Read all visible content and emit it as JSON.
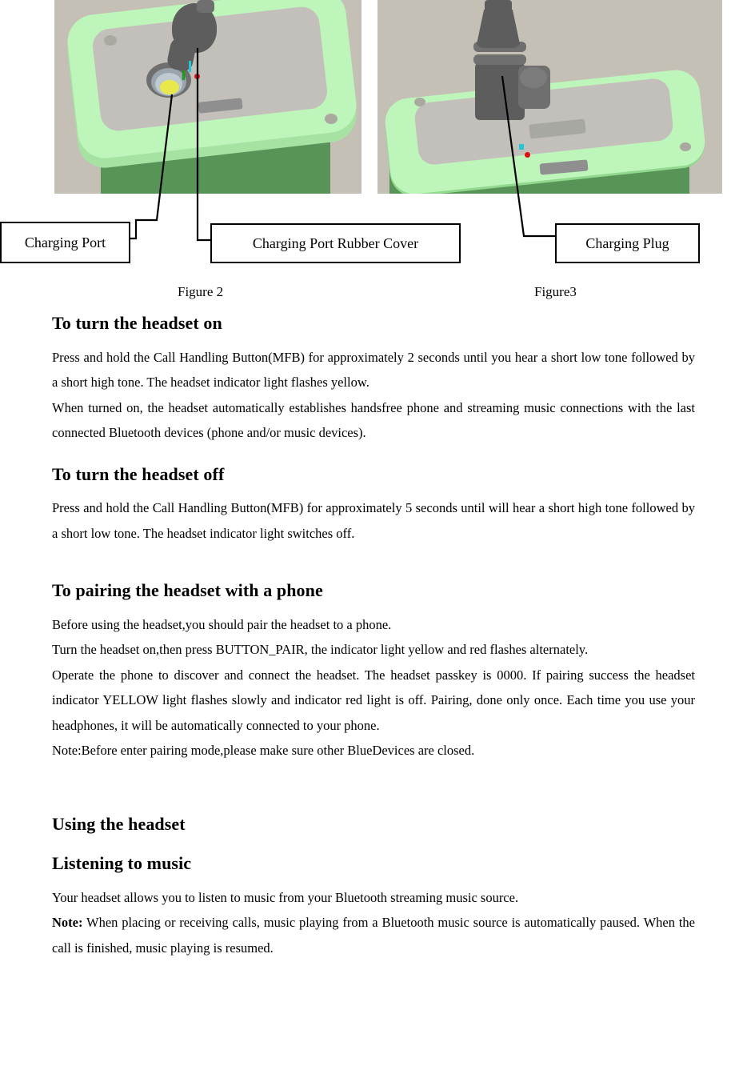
{
  "figures": {
    "labels": [
      {
        "id": "charging-port",
        "text": "Charging Port"
      },
      {
        "id": "charging-port-rubber-cover",
        "text": "Charging Port Rubber Cover"
      },
      {
        "id": "charging-plug",
        "text": "Charging Plug"
      }
    ],
    "captions": [
      {
        "id": "figure-2",
        "text": "Figure 2"
      },
      {
        "id": "figure-3",
        "text": "Figure3"
      }
    ],
    "colors": {
      "background": "#c5c0b6",
      "body_green": "#589358",
      "rim_light_green": "#bdf5ba",
      "inner_gray": "#c3c0bb",
      "plug_dark_gray": "#5d5d5d",
      "indicator_yellow": "#e8e84b",
      "axis_red": "#e01010",
      "axis_cyan": "#21c8d8",
      "axis_green": "#16a016"
    }
  },
  "sections": [
    {
      "id": "turn-on",
      "heading": "To turn the headset on",
      "paragraphs": [
        "Press and hold the Call Handling Button(MFB) for approximately 2 seconds until you hear a short low tone followed by a short high tone. The headset indicator light flashes yellow.",
        "When turned on, the headset automatically establishes handsfree phone and streaming music connections with the last connected Bluetooth devices (phone and/or music devices)."
      ]
    },
    {
      "id": "turn-off",
      "heading": "To turn the headset off",
      "paragraphs": [
        "Press and hold the Call Handling Button(MFB) for approximately 5 seconds until will hear a short high tone followed by a short low tone. The headset indicator light switches off."
      ]
    },
    {
      "id": "pairing",
      "heading": "To pairing the headset with a phone",
      "paragraphs": [
        "Before using the headset,you should pair the headset to a phone.",
        "Turn the headset on,then press BUTTON_PAIR, the indicator light yellow and red flashes alternately.",
        "Operate the phone to discover and connect the headset. The headset passkey is 0000. If pairing success the headset indicator YELLOW light flashes slowly and indicator red light is off. Pairing, done only once. Each time you use your headphones, it will be automatically connected to your phone.",
        "Note:Before enter pairing mode,please make sure other BlueDevices are closed."
      ]
    },
    {
      "id": "using-the-headset",
      "heading": "Using the headset",
      "paragraphs": []
    },
    {
      "id": "listening-to-music",
      "heading": "Listening to music",
      "paragraphs": [
        "Your headset allows you to listen to music from your Bluetooth streaming music source."
      ],
      "note": {
        "label": "Note:",
        "text": " When placing or receiving calls, music playing from a Bluetooth music source is automatically paused. When the call is finished, music playing is resumed."
      }
    }
  ]
}
